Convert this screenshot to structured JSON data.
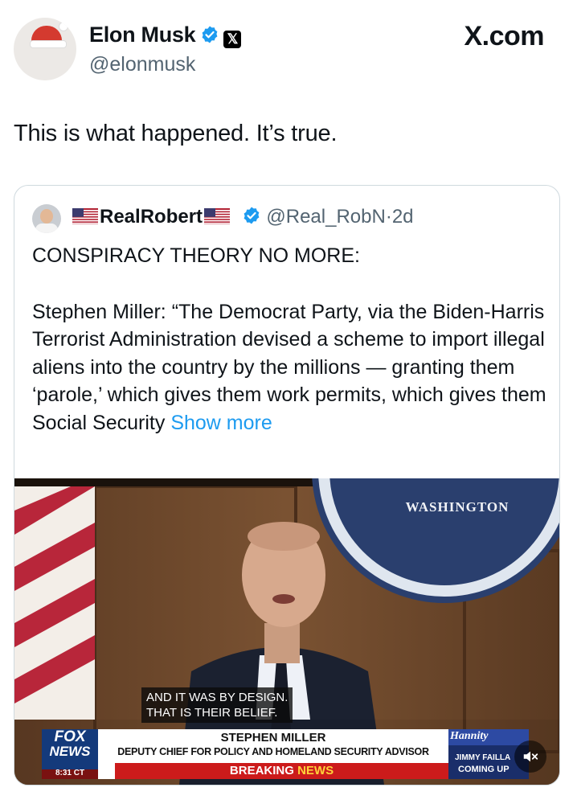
{
  "header": {
    "author_name": "Elon Musk",
    "author_handle": "@elonmusk",
    "verified_icon": "verified-badge-icon",
    "affiliation_icon": "x-logo-icon",
    "x_logo_glyph": "𝕏",
    "brand": "X.com"
  },
  "post": {
    "text": "This is what happened. It’s true."
  },
  "quoted": {
    "author_name": "RealRobert",
    "author_handle": "@Real_RobN",
    "separator": "·",
    "time": "2d",
    "headline": "CONSPIRACY THEORY NO MORE:",
    "body": "Stephen Miller: “The Democrat Party, via the Biden-Harris Terrorist Administration devised a scheme to import illegal aliens into the country by the millions — granting them ‘parole,’ which gives them work permits, which gives them Social Security",
    "show_more": "Show more"
  },
  "video": {
    "seal_text": "WASHINGTON",
    "caption_line1": "AND IT WAS BY DESIGN.",
    "caption_line2": "THAT IS THEIR BELIEF.",
    "network_line1": "FOX",
    "network_line2": "NEWS",
    "clock": "8:31 CT",
    "lower_third_name": "STEPHEN MILLER",
    "lower_third_title": "DEPUTY CHIEF FOR POLICY AND HOMELAND SECURITY ADVISOR",
    "breaking_1": "BREAKING",
    "breaking_2": "NEWS",
    "show_logo": "Hannity",
    "promo_name": "JIMMY FAILLA",
    "promo_label": "COMING UP",
    "mute_icon": "mute-icon"
  },
  "colors": {
    "link": "#1d9bf0",
    "muted_text": "#536471",
    "verified": "#1d9bf0",
    "border": "#cfd9de"
  }
}
